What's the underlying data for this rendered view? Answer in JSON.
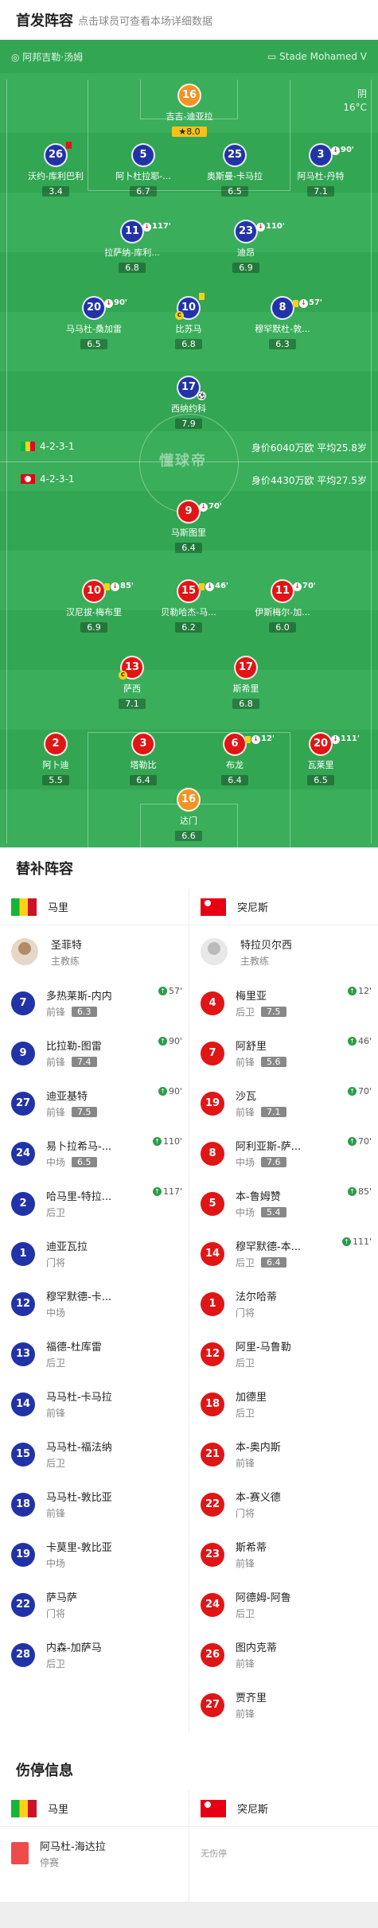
{
  "header": {
    "title": "首发阵容",
    "subtitle": "点击球员可查看本场详细数据"
  },
  "pitch": {
    "home_venue_label": "阿邦吉勒·汤姆",
    "away_venue_label": "Stade Mohamed V",
    "weather": "阴",
    "temperature": "16°C",
    "watermark": "懂球帝",
    "home_formation": "4-2-3-1",
    "home_value": "身价6040万欧 平均25.8岁",
    "away_formation": "4-2-3-1",
    "away_value": "身价4430万欧 平均27.5岁"
  },
  "home_players": [
    {
      "num": "16",
      "name": "吉吉-迪亚拉",
      "rating": "8.0",
      "best": true
    },
    {
      "num": "26",
      "name": "沃约-库利巴利",
      "rating": "3.4"
    },
    {
      "num": "5",
      "name": "阿卜杜拉耶-...",
      "rating": "6.7"
    },
    {
      "num": "25",
      "name": "奥斯曼-卡马拉",
      "rating": "6.5"
    },
    {
      "num": "3",
      "name": "阿马杜-丹特",
      "rating": "7.1",
      "ev": "90'"
    },
    {
      "num": "11",
      "name": "拉萨纳-库利...",
      "rating": "6.8",
      "ev": "117'"
    },
    {
      "num": "23",
      "name": "迪昂",
      "rating": "6.9",
      "ev": "110'"
    },
    {
      "num": "20",
      "name": "马马杜-桑加雷",
      "rating": "6.5",
      "ev": "90'"
    },
    {
      "num": "10",
      "name": "比苏马",
      "rating": "6.8"
    },
    {
      "num": "8",
      "name": "穆罕默杜-敦...",
      "rating": "6.3",
      "ev": "57'"
    },
    {
      "num": "17",
      "name": "西纳约科",
      "rating": "7.9"
    }
  ],
  "away_players": [
    {
      "num": "9",
      "name": "马斯图里",
      "rating": "6.4",
      "ev": "70'"
    },
    {
      "num": "10",
      "name": "汉尼拔-梅布里",
      "rating": "6.9",
      "ev": "85'"
    },
    {
      "num": "15",
      "name": "贝勒哈杰-马...",
      "rating": "6.2",
      "ev": "46'"
    },
    {
      "num": "11",
      "name": "伊斯梅尔-加...",
      "rating": "6.0",
      "ev": "70'"
    },
    {
      "num": "13",
      "name": "萨西",
      "rating": "7.1"
    },
    {
      "num": "17",
      "name": "斯希里",
      "rating": "6.8"
    },
    {
      "num": "2",
      "name": "阿卜迪",
      "rating": "5.5"
    },
    {
      "num": "3",
      "name": "塔勒比",
      "rating": "6.4"
    },
    {
      "num": "6",
      "name": "布龙",
      "rating": "6.4",
      "ev": "12'"
    },
    {
      "num": "20",
      "name": "瓦莱里",
      "rating": "6.5",
      "ev": "111'"
    },
    {
      "num": "16",
      "name": "达门",
      "rating": "6.6"
    }
  ],
  "subs_section": {
    "title": "替补阵容",
    "home_team": "马里",
    "away_team": "突尼斯",
    "home_coach": {
      "name": "圣菲特",
      "role": "主教练"
    },
    "away_coach": {
      "name": "特拉贝尔西",
      "role": "主教练"
    }
  },
  "home_subs": [
    {
      "num": "7",
      "name": "多热莱斯-内内",
      "pos": "前锋",
      "rating": "6.3",
      "ev": "57'"
    },
    {
      "num": "9",
      "name": "比拉勒-图雷",
      "pos": "前锋",
      "rating": "7.4",
      "ev": "90'"
    },
    {
      "num": "27",
      "name": "迪亚基特",
      "pos": "前锋",
      "rating": "7.5",
      "ev": "90'"
    },
    {
      "num": "24",
      "name": "易卜拉希马-...",
      "pos": "中场",
      "rating": "6.5",
      "ev": "110'"
    },
    {
      "num": "2",
      "name": "哈马里-特拉...",
      "pos": "后卫",
      "ev": "117'"
    },
    {
      "num": "1",
      "name": "迪亚瓦拉",
      "pos": "门将"
    },
    {
      "num": "12",
      "name": "穆罕默德-卡...",
      "pos": "中场"
    },
    {
      "num": "13",
      "name": "福德-杜库雷",
      "pos": "后卫"
    },
    {
      "num": "14",
      "name": "马马杜-卡马拉",
      "pos": "前锋"
    },
    {
      "num": "15",
      "name": "马马杜-福法纳",
      "pos": "后卫"
    },
    {
      "num": "18",
      "name": "马马杜-敦比亚",
      "pos": "前锋"
    },
    {
      "num": "19",
      "name": "卡莫里-敦比亚",
      "pos": "中场"
    },
    {
      "num": "22",
      "name": "萨马萨",
      "pos": "门将"
    },
    {
      "num": "28",
      "name": "内森-加萨马",
      "pos": "后卫"
    }
  ],
  "away_subs": [
    {
      "num": "4",
      "name": "梅里亚",
      "pos": "后卫",
      "rating": "7.5",
      "ev": "12'"
    },
    {
      "num": "7",
      "name": "阿舒里",
      "pos": "前锋",
      "rating": "5.6",
      "ev": "46'"
    },
    {
      "num": "19",
      "name": "沙瓦",
      "pos": "前锋",
      "rating": "7.1",
      "ev": "70'"
    },
    {
      "num": "8",
      "name": "阿利亚斯-萨...",
      "pos": "中场",
      "rating": "7.6",
      "ev": "70'"
    },
    {
      "num": "5",
      "name": "本-鲁姆赞",
      "pos": "中场",
      "rating": "5.4",
      "ev": "85'"
    },
    {
      "num": "14",
      "name": "穆罕默德-本...",
      "pos": "后卫",
      "rating": "6.4",
      "ev": "111'"
    },
    {
      "num": "1",
      "name": "法尔哈蒂",
      "pos": "门将"
    },
    {
      "num": "12",
      "name": "阿里-马鲁勒",
      "pos": "后卫"
    },
    {
      "num": "18",
      "name": "加德里",
      "pos": "后卫"
    },
    {
      "num": "21",
      "name": "本-奥内斯",
      "pos": "前锋"
    },
    {
      "num": "22",
      "name": "本-赛义德",
      "pos": "门将"
    },
    {
      "num": "23",
      "name": "斯希蒂",
      "pos": "前锋"
    },
    {
      "num": "24",
      "name": "阿德姆-阿鲁",
      "pos": "后卫"
    },
    {
      "num": "26",
      "name": "图内克蒂",
      "pos": "前锋"
    },
    {
      "num": "27",
      "name": "贾齐里",
      "pos": "前锋"
    }
  ],
  "injuries": {
    "title": "伤停信息",
    "home_team": "马里",
    "away_team": "突尼斯",
    "home": [
      {
        "name": "阿马杜-海达拉",
        "status": "停赛"
      }
    ],
    "away_none": "无伤停"
  }
}
